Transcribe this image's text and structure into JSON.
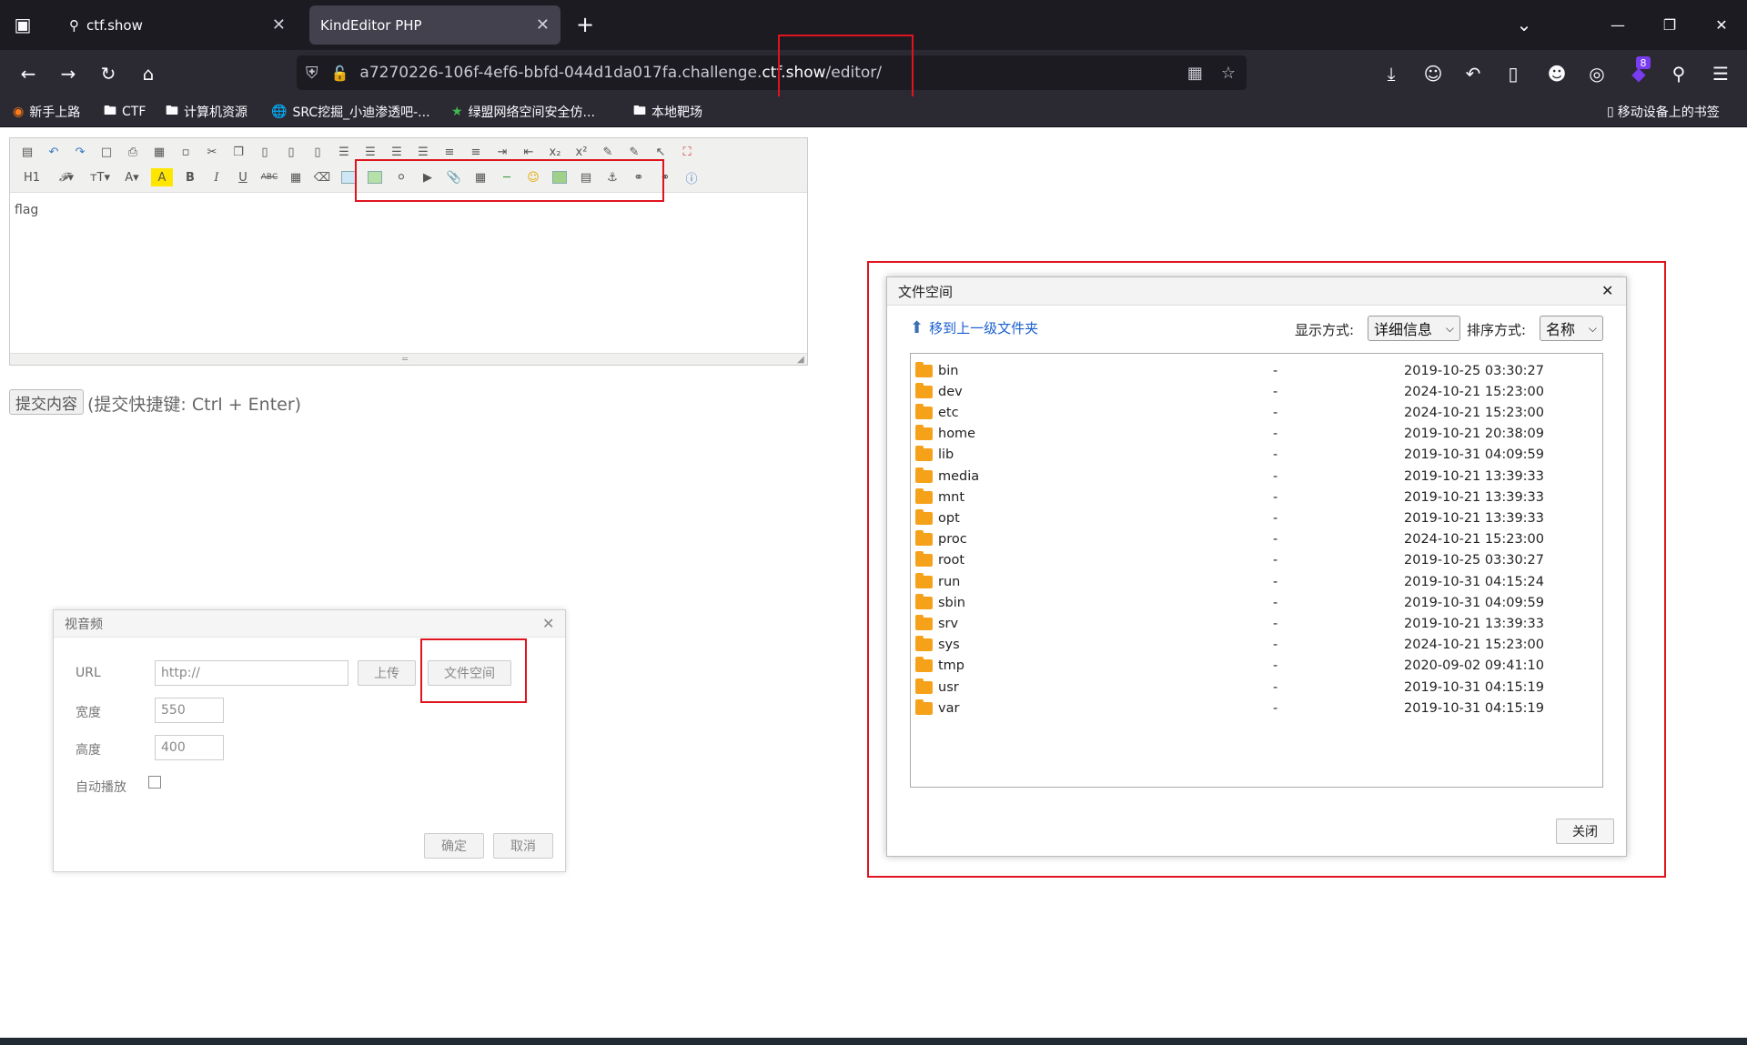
{
  "browser": {
    "tabs": [
      {
        "title": "ctf.show",
        "active": false
      },
      {
        "title": "KindEditor PHP",
        "active": true
      }
    ],
    "url": {
      "host_prefix": "a7270226-106f-4ef6-bbfd-044d1da017fa.challenge.",
      "host_domain": "ctf.show",
      "path": "/editor/"
    },
    "bookmarks": [
      "新手上路",
      "CTF",
      "计算机资源",
      "SRC挖掘_小迪渗透吧-...",
      "绿盟网络空间安全仿...",
      "本地靶场"
    ],
    "mobile_bookmarks": "移动设备上的书签",
    "extension_badge": "8"
  },
  "editor": {
    "heading_btn": "H1",
    "content": "flag",
    "submit_label": "提交内容",
    "submit_hint": "(提交快捷键: Ctrl + Enter)"
  },
  "media_dialog": {
    "title": "视音频",
    "url_label": "URL",
    "url_value": "http://",
    "upload_btn": "上传",
    "filespace_btn": "文件空间",
    "width_label": "宽度",
    "width_value": "550",
    "height_label": "高度",
    "height_value": "400",
    "autoplay_label": "自动播放",
    "ok_btn": "确定",
    "cancel_btn": "取消"
  },
  "file_manager": {
    "title": "文件空间",
    "up_label": "移到上一级文件夹",
    "view_label": "显示方式:",
    "view_value": "详细信息",
    "sort_label": "排序方式:",
    "sort_value": "名称",
    "close_btn": "关闭",
    "files": [
      {
        "name": "bin",
        "size": "-",
        "date": "2019-10-25 03:30:27"
      },
      {
        "name": "dev",
        "size": "-",
        "date": "2024-10-21 15:23:00"
      },
      {
        "name": "etc",
        "size": "-",
        "date": "2024-10-21 15:23:00"
      },
      {
        "name": "home",
        "size": "-",
        "date": "2019-10-21 20:38:09"
      },
      {
        "name": "lib",
        "size": "-",
        "date": "2019-10-31 04:09:59"
      },
      {
        "name": "media",
        "size": "-",
        "date": "2019-10-21 13:39:33"
      },
      {
        "name": "mnt",
        "size": "-",
        "date": "2019-10-21 13:39:33"
      },
      {
        "name": "opt",
        "size": "-",
        "date": "2019-10-21 13:39:33"
      },
      {
        "name": "proc",
        "size": "-",
        "date": "2024-10-21 15:23:00"
      },
      {
        "name": "root",
        "size": "-",
        "date": "2019-10-25 03:30:27"
      },
      {
        "name": "run",
        "size": "-",
        "date": "2019-10-31 04:15:24"
      },
      {
        "name": "sbin",
        "size": "-",
        "date": "2019-10-31 04:09:59"
      },
      {
        "name": "srv",
        "size": "-",
        "date": "2019-10-21 13:39:33"
      },
      {
        "name": "sys",
        "size": "-",
        "date": "2024-10-21 15:23:00"
      },
      {
        "name": "tmp",
        "size": "-",
        "date": "2020-09-02 09:41:10"
      },
      {
        "name": "usr",
        "size": "-",
        "date": "2019-10-31 04:15:19"
      },
      {
        "name": "var",
        "size": "-",
        "date": "2019-10-31 04:15:19"
      }
    ]
  },
  "colors": {
    "annotation_red": "#e0141e",
    "folder": "#f5a21a",
    "link_blue": "#1a5fd0"
  }
}
